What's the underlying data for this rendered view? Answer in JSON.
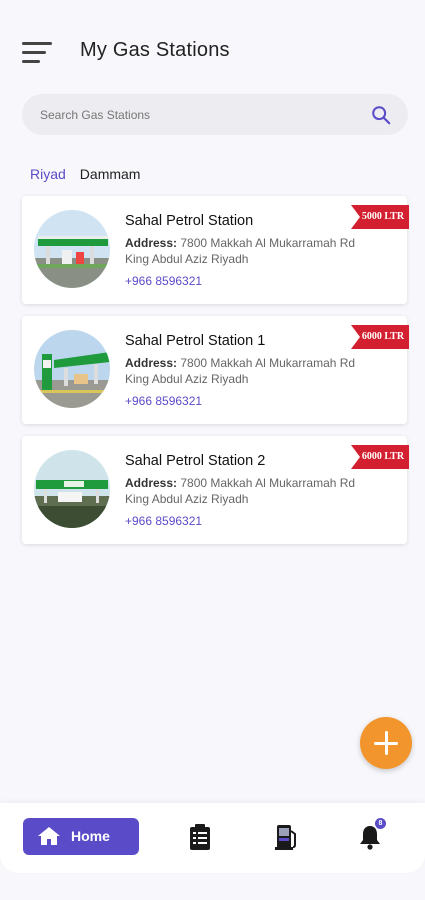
{
  "header": {
    "title": "My Gas Stations",
    "menu_icon": "hamburger-menu-icon"
  },
  "search": {
    "placeholder": "Search Gas Stations",
    "value": "",
    "icon": "search-icon"
  },
  "tabs": [
    {
      "label": "Riyad",
      "active": true
    },
    {
      "label": "Dammam",
      "active": false
    }
  ],
  "stations": [
    {
      "name": "Sahal Petrol Station",
      "address_label": "Address:",
      "address": " 7800 Makkah Al Mukarramah Rd King Abdul Aziz Riyadh",
      "phone": "+966 8596321",
      "badge": "5000 LTR"
    },
    {
      "name": "Sahal Petrol Station 1",
      "address_label": "Address:",
      "address": " 7800 Makkah Al Mukarramah Rd King Abdul Aziz Riyadh",
      "phone": "+966 8596321",
      "badge": "6000 LTR"
    },
    {
      "name": "Sahal Petrol Station 2",
      "address_label": "Address:",
      "address": " 7800 Makkah Al Mukarramah Rd King Abdul Aziz Riyadh",
      "phone": "+966 8596321",
      "badge": "6000 LTR"
    }
  ],
  "fab": {
    "icon": "plus-icon"
  },
  "bottom_nav": {
    "home_label": "Home",
    "items": [
      {
        "icon": "home-icon",
        "active": true
      },
      {
        "icon": "clipboard-list-icon",
        "active": false
      },
      {
        "icon": "fuel-pump-icon",
        "active": false
      },
      {
        "icon": "bell-icon",
        "active": false,
        "badge": "8"
      }
    ]
  },
  "colors": {
    "accent": "#5a4bc8",
    "badge_red": "#d32030",
    "fab_orange": "#f2952c",
    "background": "#f8f8fc"
  }
}
